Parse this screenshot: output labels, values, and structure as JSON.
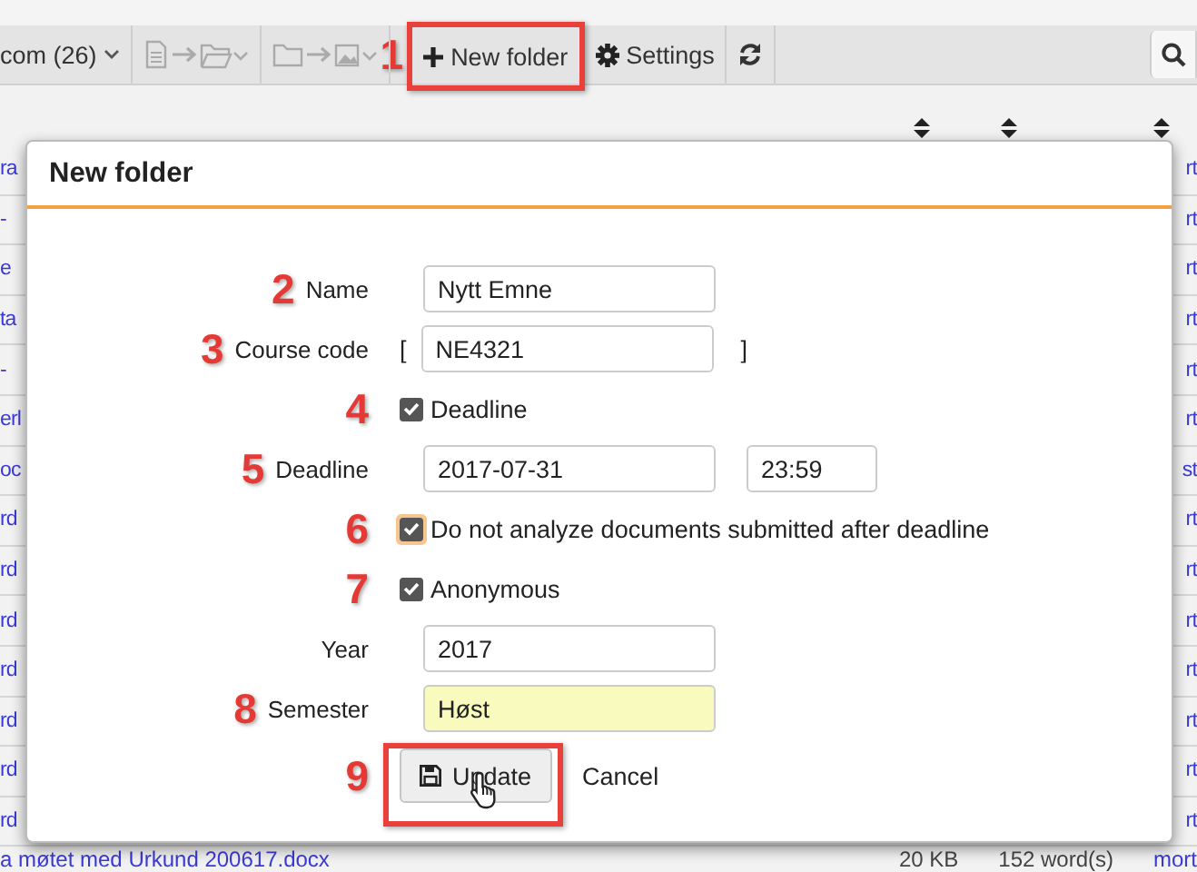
{
  "toolbar": {
    "items": [
      {
        "kind": "dropdown",
        "label": "com (26)"
      },
      {
        "kind": "doc-move"
      },
      {
        "kind": "folder-move"
      },
      {
        "kind": "new",
        "label": "New folder",
        "marker": "1",
        "highlighted": true
      },
      {
        "kind": "settings",
        "label": "Settings"
      },
      {
        "kind": "refresh"
      },
      {
        "kind": "search"
      }
    ]
  },
  "list": {
    "rows": [
      {
        "name": "ra",
        "action": "rt"
      },
      {
        "name": "-",
        "action": "rt"
      },
      {
        "name": "e",
        "action": "rt"
      },
      {
        "name": "ta",
        "action": "rt"
      },
      {
        "name": "-",
        "action": "rt"
      },
      {
        "name": "erl",
        "action": "rt"
      },
      {
        "name": "oc",
        "action": "st"
      },
      {
        "name": "rd",
        "action": "rt"
      },
      {
        "name": "rd",
        "action": "rt"
      },
      {
        "name": "rd",
        "action": "rt"
      },
      {
        "name": "rd",
        "action": "rt"
      },
      {
        "name": "rd",
        "action": "rt"
      },
      {
        "name": "rd",
        "action": "rt"
      },
      {
        "name": "rd",
        "action": "rt"
      },
      {
        "name": "a møtet med Urkund 200617.docx",
        "size": "20 KB",
        "words": "152 word(s)",
        "action": "mort"
      }
    ]
  },
  "dialog": {
    "title": "New folder",
    "fields": [
      {
        "kind": "text",
        "label": "Name",
        "value": "Nytt Emne",
        "marker": "2",
        "highlighted": false
      },
      {
        "kind": "bracketed",
        "label": "Course code",
        "open": "[",
        "value": "NE4321",
        "close": "]",
        "marker": "3"
      },
      {
        "kind": "checkbox",
        "label": "Deadline",
        "checked": true,
        "focused": false,
        "marker": "4"
      },
      {
        "kind": "datetime",
        "label": "Deadline",
        "date": "2017-07-31",
        "time": "23:59",
        "marker": "5"
      },
      {
        "kind": "checkbox",
        "label": "Do not analyze documents submitted after deadline",
        "checked": true,
        "focused": true,
        "marker": "6"
      },
      {
        "kind": "checkbox",
        "label": "Anonymous",
        "checked": true,
        "focused": false,
        "marker": "7"
      },
      {
        "kind": "text",
        "label": "Year",
        "value": "2017",
        "highlighted": false
      },
      {
        "kind": "text",
        "label": "Semester",
        "value": "Høst",
        "marker": "8",
        "highlighted": true
      }
    ],
    "buttons": [
      {
        "kind": "primary",
        "label": "Update",
        "marker": "9",
        "highlighted": true,
        "hovered": true
      },
      {
        "kind": "link",
        "label": "Cancel"
      }
    ]
  }
}
